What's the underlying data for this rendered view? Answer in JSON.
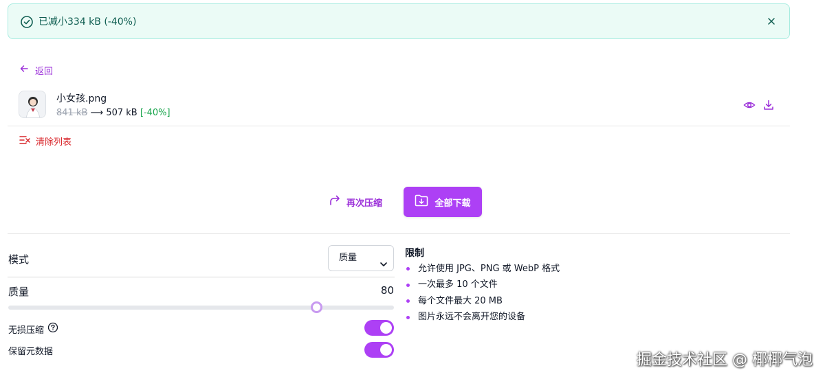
{
  "alert": {
    "message": "已减小334 kB (-40%)"
  },
  "nav": {
    "back_label": "返回"
  },
  "file": {
    "name": "小女孩.png",
    "original_size": "841 kB",
    "arrow": "⟶",
    "new_size": "507 kB",
    "reduction": "[-40%]"
  },
  "list": {
    "clear_label": "清除列表"
  },
  "actions": {
    "recompress_label": "再次压缩",
    "download_all_label": "全部下载"
  },
  "settings": {
    "mode_label": "模式",
    "mode_value": "质量",
    "quality_label": "质量",
    "quality_value": "80",
    "quality_slider_level": 80,
    "lossless_label": "无损压缩",
    "lossless_on": true,
    "keep_meta_label": "保留元数据",
    "keep_meta_on": true
  },
  "limits": {
    "title": "限制",
    "items": [
      "允许使用 JPG、PNG 或 WebP 格式",
      "一次最多 10 个文件",
      "每个文件最大 20 MB",
      "图片永远不会离开您的设备"
    ]
  },
  "watermark": "掘金技术社区 @ 椰椰气泡",
  "colors": {
    "accent": "#ad40f5",
    "danger": "#d9272c",
    "success": "#16a34a",
    "alert_bg": "#ebfbf6"
  }
}
